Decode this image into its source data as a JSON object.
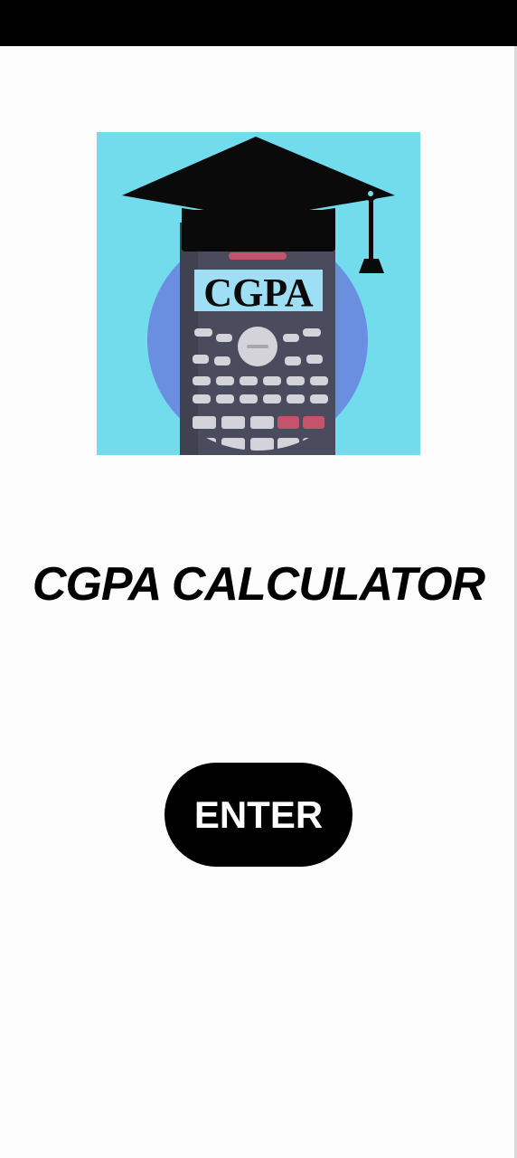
{
  "logo": {
    "icon": "graduation-cap-calculator-icon",
    "display_text": "CGPA",
    "colors": {
      "background": "#72dced",
      "circle": "#6a8ee0",
      "cap": "#0a0a0a",
      "calculator_body": "#4a4b5d",
      "screen": "#9edff5",
      "keys": "#d3d3d9",
      "accent_keys": "#c4536b"
    }
  },
  "title": "CGPA CALCULATOR",
  "enter_button": {
    "label": "ENTER"
  },
  "colors": {
    "page_background": "#fdfdfd",
    "status_bar": "#000000",
    "button_background": "#000000",
    "button_text": "#ffffff"
  }
}
